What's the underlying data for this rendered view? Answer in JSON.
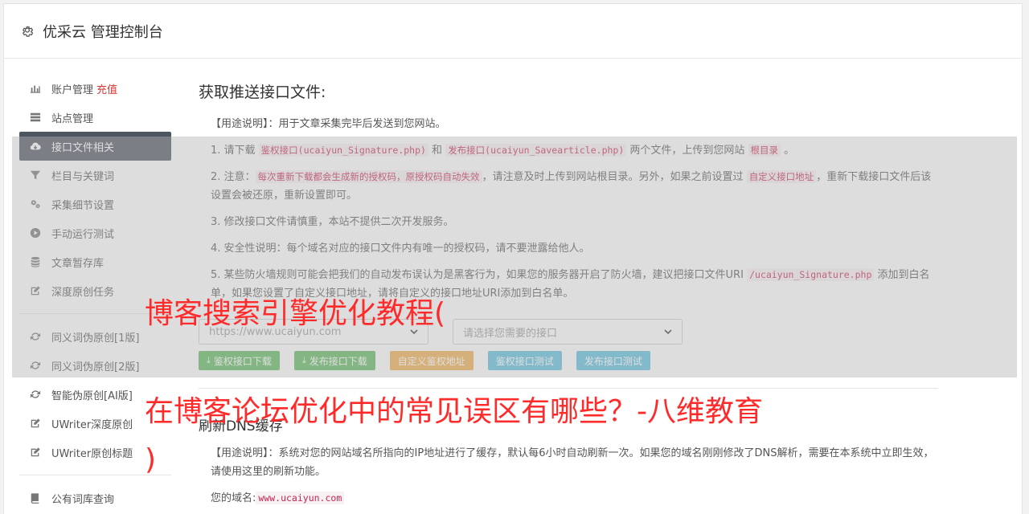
{
  "header": {
    "title": "优采云 管理控制台"
  },
  "sidebar": {
    "items": [
      {
        "label": "账户管理",
        "extra": "充值",
        "icon": "bar-chart-icon"
      },
      {
        "label": "站点管理",
        "icon": "server-icon"
      },
      {
        "label": "接口文件相关",
        "icon": "cloud-download-icon",
        "active": true
      },
      {
        "label": "栏目与关键词",
        "icon": "filter-icon"
      },
      {
        "label": "采集细节设置",
        "icon": "gears-icon"
      },
      {
        "label": "手动运行测试",
        "icon": "play-icon"
      },
      {
        "label": "文章暂存库",
        "icon": "database-icon"
      },
      {
        "label": "深度原创任务",
        "icon": "edit-icon"
      }
    ],
    "items2": [
      {
        "label": "同义词伪原创[1版]",
        "icon": "refresh-icon"
      },
      {
        "label": "同义词伪原创[2版]",
        "icon": "refresh-icon"
      },
      {
        "label": "智能伪原创[AI版]",
        "icon": "refresh-icon"
      },
      {
        "label": "UWriter深度原创",
        "icon": "edit-icon"
      },
      {
        "label": "UWriter原创标题",
        "icon": "edit-icon"
      }
    ],
    "items3": [
      {
        "label": "公有词库查询",
        "icon": "book-icon"
      }
    ]
  },
  "main": {
    "section_title": "获取推送接口文件:",
    "usage_label": "【用途说明】",
    "usage_text": "：用于文章采集完毕后发送到您网站。",
    "step1_a": "1. 请下载 ",
    "step1_code1": "鉴权接口(ucaiyun_Signature.php)",
    "step1_b": " 和 ",
    "step1_code2": "发布接口(ucaiyun_Savearticle.php)",
    "step1_c": " 两个文件，上传到您网站 ",
    "step1_code3": "根目录",
    "step1_d": " 。",
    "step2_a": "2. 注意：",
    "step2_code1": "每次重新下载都会生成新的授权码，原授权码自动失效",
    "step2_b": "，请注意及时上传到网站根目录。另外，如果之前设置过 ",
    "step2_code2": "自定义接口地址",
    "step2_c": "，重新下载接口文件后该设置会被还原，重新设置即可。",
    "step3": "3. 修改接口文件请慎重，本站不提供二次开发服务。",
    "step4": "4. 安全性说明：每个域名对应的接口文件内有唯一的授权码，请不要泄露给他人。",
    "step5_a": "5. 某些防火墙规则可能会把我们的自动发布误认为是黑客行为，如果您的服务器开启了防火墙，建议把接口文件URI ",
    "step5_code": "/ucaiyun_Signature.php",
    "step5_b": " 添加到白名单，如果您设置了自定义接口地址，请将自定义的接口地址URI添加到白名单。",
    "site_select": "https://www.ucaiyun.com",
    "interface_select": "请选择您需要的接口",
    "buttons": {
      "sign_download": "鉴权接口下载",
      "publish_download": "发布接口下载",
      "custom_sign": "自定义鉴权地址",
      "sign_test": "鉴权接口测试",
      "publish_test": "发布接口测试"
    },
    "dns_title": "刷新DNS缓存",
    "dns_usage_label": "【用途说明】",
    "dns_usage_text": "：系统对您的网站域名所指向的IP地址进行了缓存，默认每6小时自动刷新一次。如果您的域名刚刚修改了DNS解析，需要在本系统中立即生效，请使用这里的刷新功能。",
    "domain_label": "您的域名:",
    "domain_value": "www.ucaiyun.com"
  },
  "overlay_text": {
    "line1": "博客搜索引擎优化教程(",
    "line2": "在博客论坛优化中的常见误区有哪些？-八维教育",
    "line3": ")"
  },
  "colors": {
    "active_nav": "#4d5560",
    "red_text": "#ff2a2a",
    "green_btn": "#5cb85c",
    "orange_btn": "#f0ad4e",
    "blue_btn": "#5bc0de"
  }
}
